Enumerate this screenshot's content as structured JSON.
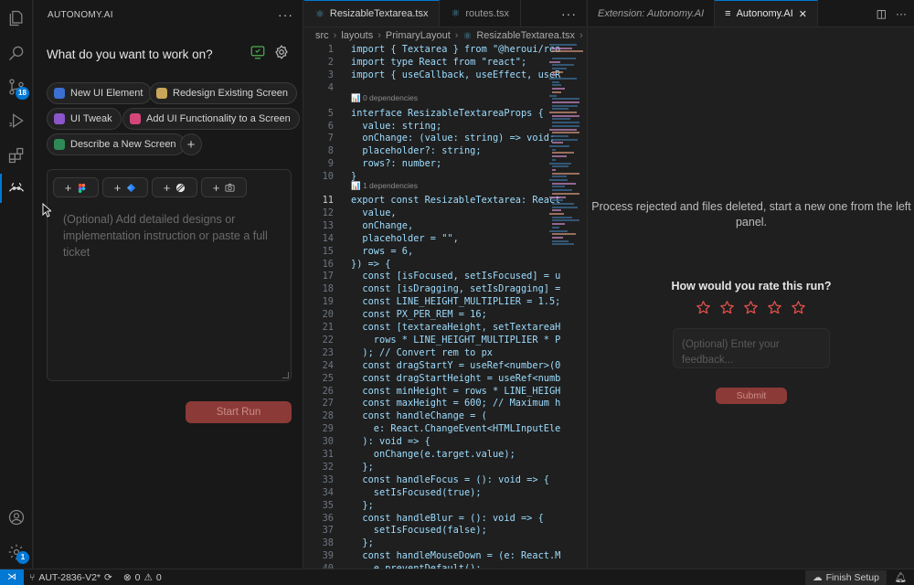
{
  "sidebar": {
    "header_title": "AUTONOMY.AI",
    "panel_title": "What do you want to work on?",
    "chips": [
      {
        "label": "New UI Element",
        "icon": "puzzle-icon"
      },
      {
        "label": "Redesign Existing Screen",
        "icon": "palette-icon"
      },
      {
        "label": "UI Tweak",
        "icon": "sliders-icon"
      },
      {
        "label": "Add UI Functionality to a Screen",
        "icon": "wand-icon"
      },
      {
        "label": "Describe a New Screen",
        "icon": "layout-icon"
      }
    ],
    "prompt_placeholder": "(Optional) Add detailed designs or implementation instruction or paste a full ticket",
    "start_button": "Start Run"
  },
  "activity_badges": {
    "source_control": "18",
    "settings": "1"
  },
  "editor": {
    "tabs": [
      {
        "label": "ResizableTextarea.tsx",
        "active": true
      },
      {
        "label": "routes.tsx",
        "active": false
      }
    ],
    "breadcrumb": [
      "src",
      "layouts",
      "PrimaryLayout",
      "ResizableTextarea.tsx",
      "[∘] ..."
    ],
    "code_lens": {
      "deps0": "0 dependencies",
      "deps1": "1 dependencies"
    },
    "lines": [
      {
        "n": "1",
        "t": "import { Textarea } from \"@heroui/reac"
      },
      {
        "n": "2",
        "t": "import type React from \"react\";"
      },
      {
        "n": "3",
        "t": "import { useCallback, useEffect, useRe"
      },
      {
        "n": "4",
        "t": ""
      },
      {
        "n": "5",
        "t": "interface ResizableTextareaProps {"
      },
      {
        "n": "6",
        "t": "  value: string;"
      },
      {
        "n": "7",
        "t": "  onChange: (value: string) => void;"
      },
      {
        "n": "8",
        "t": "  placeholder?: string;"
      },
      {
        "n": "9",
        "t": "  rows?: number;"
      },
      {
        "n": "10",
        "t": "}"
      },
      {
        "n": "11",
        "t": "export const ResizableTextarea: React."
      },
      {
        "n": "12",
        "t": "  value,"
      },
      {
        "n": "13",
        "t": "  onChange,"
      },
      {
        "n": "14",
        "t": "  placeholder = \"\","
      },
      {
        "n": "15",
        "t": "  rows = 6,"
      },
      {
        "n": "16",
        "t": "}) => {"
      },
      {
        "n": "17",
        "t": "  const [isFocused, setIsFocused] = us"
      },
      {
        "n": "18",
        "t": "  const [isDragging, setIsDragging] ="
      },
      {
        "n": "19",
        "t": "  const LINE_HEIGHT_MULTIPLIER = 1.5;"
      },
      {
        "n": "20",
        "t": "  const PX_PER_REM = 16;"
      },
      {
        "n": "21",
        "t": "  const [textareaHeight, setTextareaHe"
      },
      {
        "n": "22",
        "t": "    rows * LINE_HEIGHT_MULTIPLIER * PX"
      },
      {
        "n": "23",
        "t": "  ); // Convert rem to px"
      },
      {
        "n": "24",
        "t": "  const dragStartY = useRef<number>(0)"
      },
      {
        "n": "25",
        "t": "  const dragStartHeight = useRef<numbe"
      },
      {
        "n": "26",
        "t": "  const minHeight = rows * LINE_HEIGHT"
      },
      {
        "n": "27",
        "t": "  const maxHeight = 600; // Maximum he"
      },
      {
        "n": "28",
        "t": "  const handleChange = ("
      },
      {
        "n": "29",
        "t": "    e: React.ChangeEvent<HTMLInputElem"
      },
      {
        "n": "30",
        "t": "  ): void => {"
      },
      {
        "n": "31",
        "t": "    onChange(e.target.value);"
      },
      {
        "n": "32",
        "t": "  };"
      },
      {
        "n": "33",
        "t": "  const handleFocus = (): void => {"
      },
      {
        "n": "34",
        "t": "    setIsFocused(true);"
      },
      {
        "n": "35",
        "t": "  };"
      },
      {
        "n": "36",
        "t": "  const handleBlur = (): void => {"
      },
      {
        "n": "37",
        "t": "    setIsFocused(false);"
      },
      {
        "n": "38",
        "t": "  };"
      },
      {
        "n": "39",
        "t": "  const handleMouseDown = (e: React.Mo"
      },
      {
        "n": "40",
        "t": "    e.preventDefault();"
      }
    ]
  },
  "right_panel": {
    "tabs": [
      {
        "label": "Extension: Autonomy.AI",
        "active": false
      },
      {
        "label": "Autonomy.AI",
        "active": true
      }
    ],
    "message": "Process rejected and files deleted, start a new one from the left panel.",
    "rate_title": "How would you rate this run?",
    "feedback_placeholder": "(Optional) Enter your feedback...",
    "submit_label": "Submit",
    "star_count": 5
  },
  "statusbar": {
    "branch": "AUT-2836-V2*",
    "errors": "0",
    "warnings": "0",
    "finish_setup": "Finish Setup"
  },
  "colors": {
    "accent": "#0078d4",
    "brand_button": "#8b3a37",
    "star": "#e0504a"
  }
}
